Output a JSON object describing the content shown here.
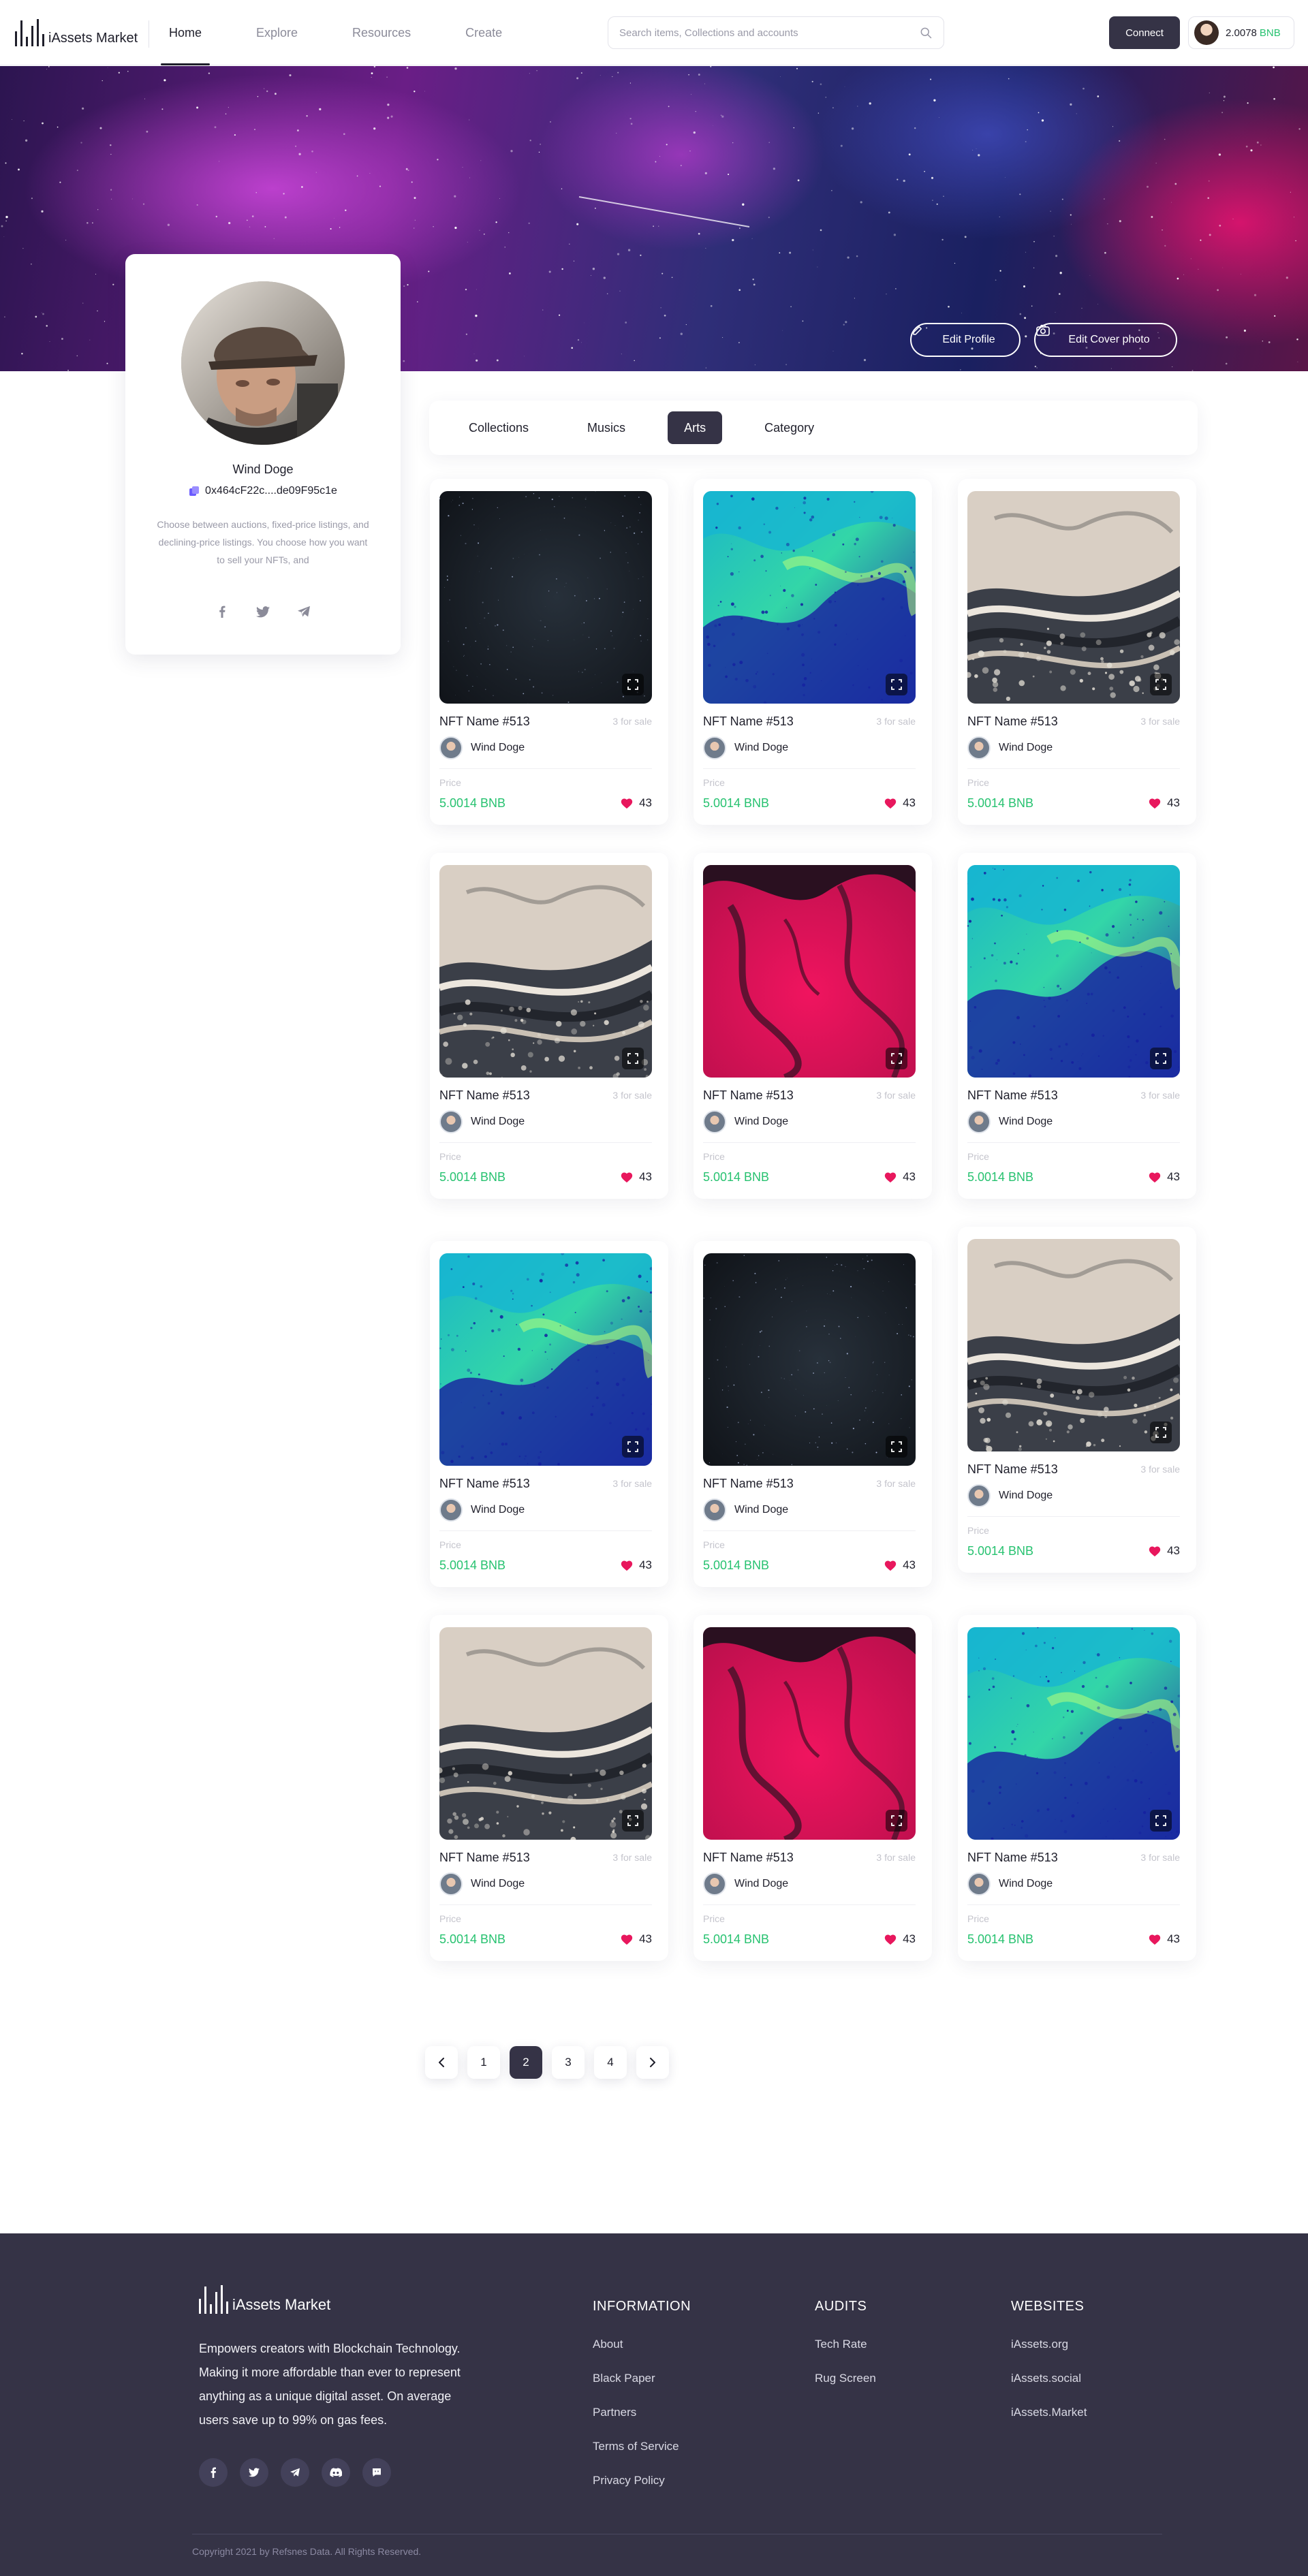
{
  "header": {
    "logo_text": "iAssets Market",
    "nav": [
      {
        "label": "Home",
        "active": true
      },
      {
        "label": "Explore",
        "active": false
      },
      {
        "label": "Resources",
        "active": false
      },
      {
        "label": "Create",
        "active": false
      }
    ],
    "search_placeholder": "Search items, Collections and accounts",
    "connect_label": "Connect",
    "wallet_amount": "2.0078",
    "wallet_unit": "BNB"
  },
  "cover": {
    "edit_profile_label": "Edit Profile",
    "edit_cover_label": "Edit Cover photo"
  },
  "profile": {
    "name": "Wind Doge",
    "address": "0x464cF22c....de09F95c1e",
    "bio": "Choose between auctions, fixed-price listings, and declining-price listings. You choose how you want to sell your NFTs, and",
    "social": [
      "facebook-icon",
      "twitter-icon",
      "telegram-icon"
    ]
  },
  "tabs": [
    {
      "label": "Collections",
      "active": false
    },
    {
      "label": "Musics",
      "active": false
    },
    {
      "label": "Arts",
      "active": true
    },
    {
      "label": "Category",
      "active": false
    }
  ],
  "cards": [
    {
      "art": "space",
      "title": "NFT Name #513",
      "sale": "3 for sale",
      "owner": "Wind Doge",
      "price_label": "Price",
      "price": "5.0014 BNB",
      "likes": "43"
    },
    {
      "art": "teal",
      "title": "NFT Name #513",
      "sale": "3 for sale",
      "owner": "Wind Doge",
      "price_label": "Price",
      "price": "5.0014 BNB",
      "likes": "43"
    },
    {
      "art": "marble",
      "title": "NFT Name #513",
      "sale": "3 for sale",
      "owner": "Wind Doge",
      "price_label": "Price",
      "price": "5.0014 BNB",
      "likes": "43"
    },
    {
      "art": "marble",
      "title": "NFT Name #513",
      "sale": "3 for sale",
      "owner": "Wind Doge",
      "price_label": "Price",
      "price": "5.0014 BNB",
      "likes": "43"
    },
    {
      "art": "pink",
      "title": "NFT Name #513",
      "sale": "3 for sale",
      "owner": "Wind Doge",
      "price_label": "Price",
      "price": "5.0014 BNB",
      "likes": "43"
    },
    {
      "art": "teal",
      "title": "NFT Name #513",
      "sale": "3 for sale",
      "owner": "Wind Doge",
      "price_label": "Price",
      "price": "5.0014 BNB",
      "likes": "43"
    },
    {
      "art": "teal",
      "title": "NFT Name #513",
      "sale": "3 for sale",
      "owner": "Wind Doge",
      "price_label": "Price",
      "price": "5.0014 BNB",
      "likes": "43"
    },
    {
      "art": "space",
      "title": "NFT Name #513",
      "sale": "3 for sale",
      "owner": "Wind Doge",
      "price_label": "Price",
      "price": "5.0014 BNB",
      "likes": "43"
    },
    {
      "art": "marble",
      "title": "NFT Name #513",
      "sale": "3 for sale",
      "owner": "Wind Doge",
      "price_label": "Price",
      "price": "5.0014 BNB",
      "likes": "43"
    },
    {
      "art": "marble",
      "title": "NFT Name #513",
      "sale": "3 for sale",
      "owner": "Wind Doge",
      "price_label": "Price",
      "price": "5.0014 BNB",
      "likes": "43"
    },
    {
      "art": "pink",
      "title": "NFT Name #513",
      "sale": "3 for sale",
      "owner": "Wind Doge",
      "price_label": "Price",
      "price": "5.0014 BNB",
      "likes": "43"
    },
    {
      "art": "teal",
      "title": "NFT Name #513",
      "sale": "3 for sale",
      "owner": "Wind Doge",
      "price_label": "Price",
      "price": "5.0014 BNB",
      "likes": "43"
    }
  ],
  "pagination": {
    "pages": [
      "1",
      "2",
      "3",
      "4"
    ],
    "current": "2"
  },
  "footer": {
    "logo_text": "iAssets Market",
    "description": "Empowers creators with Blockchain Technology. Making it more affordable than ever to represent anything as a unique digital asset. On average users save up to 99% on gas fees.",
    "social": [
      "facebook-icon",
      "twitter-icon",
      "telegram-icon",
      "discord-icon",
      "chat-icon"
    ],
    "columns": [
      {
        "title": "INFORMATION",
        "links": [
          "About",
          "Black Paper",
          "Partners",
          "Terms of Service",
          "Privacy Policy"
        ]
      },
      {
        "title": "AUDITS",
        "links": [
          "Tech Rate",
          "Rug Screen"
        ]
      },
      {
        "title": "WEBSITES",
        "links": [
          "iAssets.org",
          "iAssets.social",
          "iAssets.Market"
        ]
      }
    ],
    "copyright": "Copyright 2021 by Refsnes Data. All Rights Reserved."
  },
  "colors": {
    "accent_dark": "#353346",
    "price_green": "#27c270",
    "like_pink": "#e8175d"
  }
}
